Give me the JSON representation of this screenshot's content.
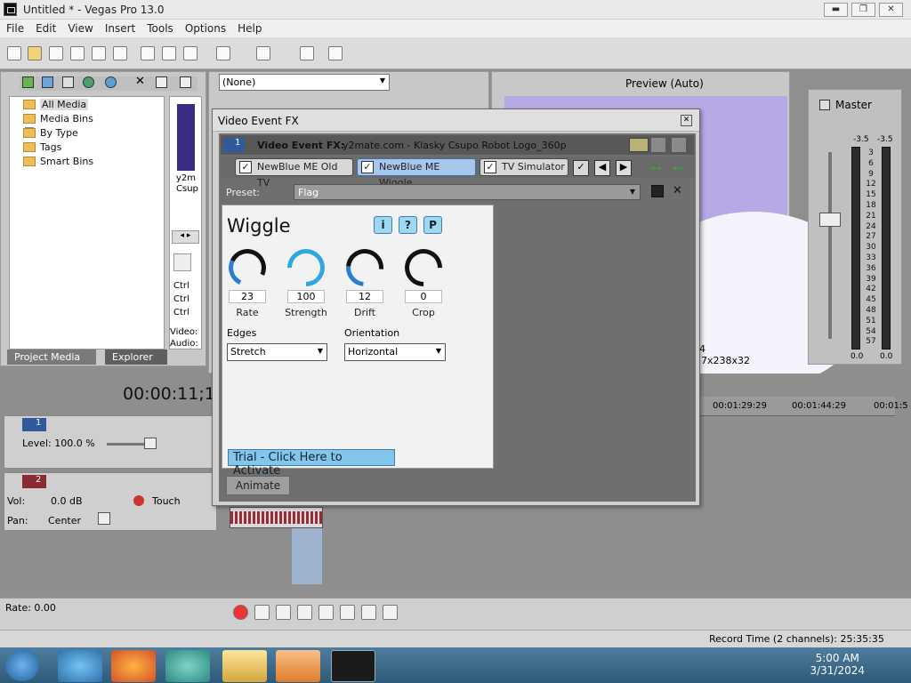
{
  "window": {
    "title": "Untitled * - Vegas Pro 13.0",
    "min": "▬",
    "max": "❐",
    "close": "✕"
  },
  "menu": [
    "File",
    "Edit",
    "View",
    "Insert",
    "Tools",
    "Options",
    "Help"
  ],
  "project_media": {
    "tree": [
      "All Media",
      "Media Bins",
      "By Type",
      "Tags",
      "Smart Bins"
    ],
    "expander": "+",
    "thumb_label_1": "y2m",
    "thumb_label_2": "Csup",
    "ctrl_labels": [
      "Ctrl",
      "Ctrl",
      "Ctrl"
    ],
    "video_label": "Video:",
    "audio_label": "Audio:",
    "tabs": [
      "Project Media",
      "Explorer"
    ]
  },
  "trimmer": {
    "selected": "(None)"
  },
  "preview": {
    "mode": "Preview (Auto)",
    "size_text": "7x238x32",
    "number": "4"
  },
  "fx_window": {
    "title": "Video Event FX",
    "close": "✕",
    "track_num": "1",
    "event_label": "Video Event FX:",
    "event_name": "y2mate.com - Klasky Csupo Robot Logo_360p",
    "plugins": [
      "NewBlue ME Old TV",
      "NewBlue ME Wiggle",
      "TV Simulator"
    ],
    "preset_label": "Preset:",
    "preset_value": "Flag",
    "plugin_title": "Wiggle",
    "buttons": [
      "i",
      "?",
      "P"
    ],
    "knobs": [
      {
        "label": "Rate",
        "value": "23"
      },
      {
        "label": "Strength",
        "value": "100"
      },
      {
        "label": "Drift",
        "value": "12"
      },
      {
        "label": "Crop",
        "value": "0"
      }
    ],
    "edges_label": "Edges",
    "edges_value": "Stretch",
    "orientation_label": "Orientation",
    "orientation_value": "Horizontal",
    "trial_text": "Trial - Click Here to Activate",
    "animate_label": "Animate"
  },
  "master": {
    "label": "Master",
    "peak_left": "-3.5",
    "peak_right": "-3.5",
    "scale": [
      "3",
      "6",
      "9",
      "12",
      "15",
      "18",
      "21",
      "24",
      "27",
      "30",
      "33",
      "36",
      "39",
      "42",
      "45",
      "48",
      "51",
      "54",
      "57"
    ],
    "floor_left": "0.0",
    "floor_right": "0.0"
  },
  "timeline": {
    "time": "00:00:11;1",
    "ruler_marks": [
      "00:01:29:29",
      "00:01:44:29",
      "00:01:5"
    ],
    "track1": {
      "num": "1",
      "level": "Level: 100.0 %"
    },
    "track2": {
      "num": "2",
      "vol": "Vol:",
      "vol_value": "0.0 dB",
      "pan": "Pan:",
      "pan_value": "Center",
      "mode": "Touch"
    },
    "meter_nums": [
      "-3",
      "12",
      "36",
      "48"
    ]
  },
  "transport": {
    "rate": "Rate: 0.00"
  },
  "status": {
    "record_time": "Record Time (2 channels): 25:35:35"
  },
  "taskbar": {
    "time": "5:00 AM",
    "date": "3/31/2024"
  }
}
